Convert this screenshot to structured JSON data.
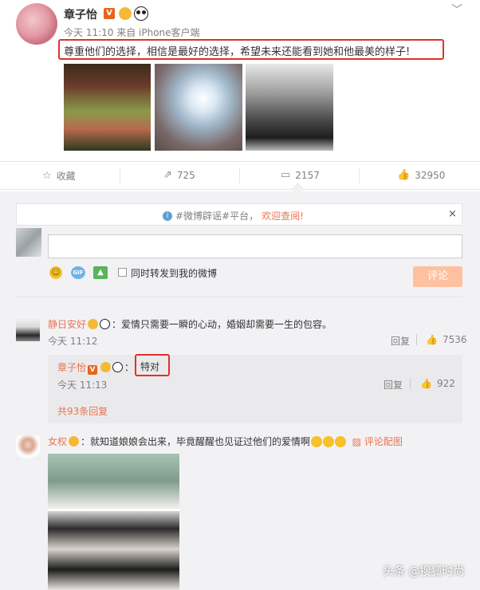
{
  "post": {
    "username": "章子怡",
    "vip_badge": "V",
    "meta": "今天 11:10 来自 iPhone客户端",
    "text": "尊重他们的选择，相信是最好的选择，希望未来还能看到她和他最美的样子!"
  },
  "actions": {
    "favorite": "收藏",
    "repost": "725",
    "comment": "2157",
    "like": "32950"
  },
  "notice": {
    "prefix": "#微博辟谣#平台，",
    "highlight": "欢迎查阅!",
    "close": "×"
  },
  "composer": {
    "checkbox_label": "同时转发到我的微博",
    "submit": "评论",
    "gif": "GIF"
  },
  "comments": [
    {
      "username": "静日安好",
      "text": "：爱情只需要一瞬的心动，婚姻却需要一生的包容。",
      "time": "今天 11:12",
      "reply": "回复",
      "likes": "7536",
      "sub_reply": {
        "username": "章子怡",
        "vip_badge": "V",
        "colon": "：",
        "text": "特对",
        "time": "今天 11:13",
        "reply": "回复",
        "likes": "922"
      },
      "more": "共93条回复"
    },
    {
      "username": "女权",
      "text": "：就知道娘娘会出来，毕竟醒醒也见证过他们的爱情啊",
      "pic_link": "评论配图"
    }
  ],
  "watermark": "头条 @搜狐时尚",
  "colors": {
    "accent": "#eb7350",
    "highlight_border": "#e0312c",
    "vip": "#e8641b"
  }
}
